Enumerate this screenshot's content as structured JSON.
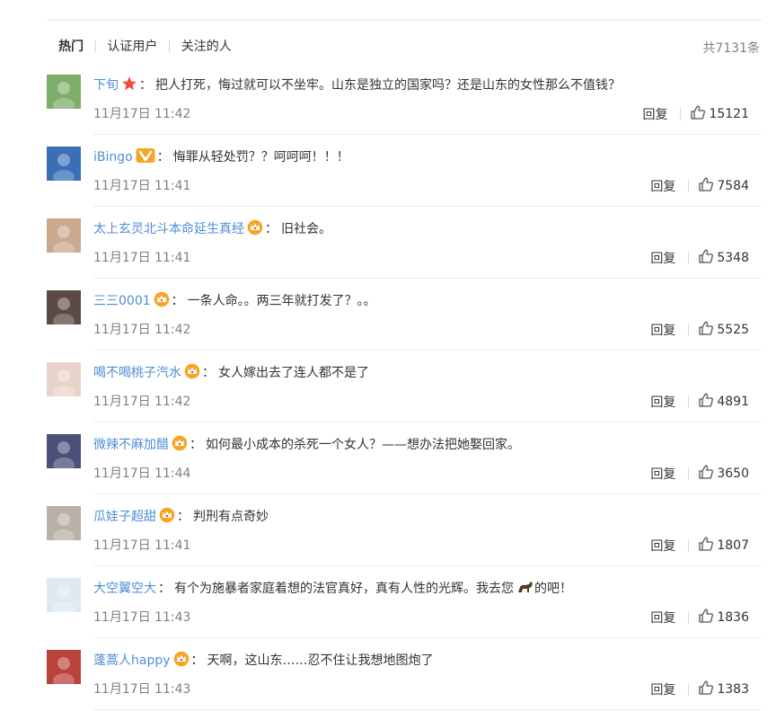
{
  "tabs": [
    {
      "label": "热门",
      "active": true
    },
    {
      "label": "认证用户",
      "active": false
    },
    {
      "label": "关注的人",
      "active": false
    }
  ],
  "total_count": "共7131条",
  "reply_label": "回复",
  "comments": [
    {
      "user": "下旬",
      "badge": "star-badge-icon",
      "text": "把人打死，悔过就可以不坐牢。山东是独立的国家吗？还是山东的女性那么不值钱？",
      "time": "11月17日 11:42",
      "likes": "15121",
      "avatar_color": "#7fae6a"
    },
    {
      "user": "iBingo",
      "badge": "v-badge-icon",
      "text": "悔罪从轻处罚？？呵呵呵！！！",
      "time": "11月17日 11:41",
      "likes": "7584",
      "avatar_color": "#3a6fb8"
    },
    {
      "user": "太上玄灵北斗本命延生真经",
      "badge": "crown-badge-icon",
      "text": "旧社会。",
      "time": "11月17日 11:41",
      "likes": "5348",
      "avatar_color": "#c9a98f"
    },
    {
      "user": "三三0001",
      "badge": "crown-badge-icon",
      "text": "一条人命。。两三年就打发了？。。",
      "time": "11月17日 11:42",
      "likes": "5525",
      "avatar_color": "#5b4a45"
    },
    {
      "user": "喝不喝桃子汽水",
      "badge": "crown-badge-icon",
      "text": "女人嫁出去了连人都不是了",
      "time": "11月17日 11:42",
      "likes": "4891",
      "avatar_color": "#e8d3c8"
    },
    {
      "user": "微辣不麻加醋",
      "badge": "crown-badge-icon",
      "text": "如何最小成本的杀死一个女人？——想办法把她娶回家。",
      "time": "11月17日 11:44",
      "likes": "3650",
      "avatar_color": "#4b4f7a"
    },
    {
      "user": "瓜娃子超甜",
      "badge": "crown-badge-icon",
      "text": "判刑有点奇妙",
      "time": "11月17日 11:41",
      "likes": "1807",
      "avatar_color": "#b8b1a8"
    },
    {
      "user": "大空翼空大",
      "badge": "",
      "text": "有个为施暴者家庭着想的法官真好，真有人性的光辉。我去您",
      "emoji": "horse-emoji-icon",
      "text_after": "的吧！",
      "time": "11月17日 11:43",
      "likes": "1836",
      "avatar_color": "#dfe9f2"
    },
    {
      "user": "蓬蒿人happy",
      "badge": "crown-badge-icon",
      "text": "天啊，这山东……忍不住让我想地图炮了",
      "time": "11月17日 11:43",
      "likes": "1383",
      "avatar_color": "#b8433a"
    }
  ]
}
